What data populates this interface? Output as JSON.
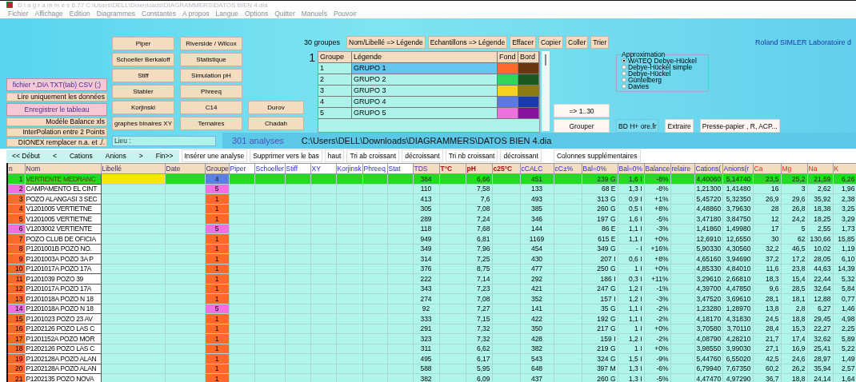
{
  "window": {
    "title": "D i a g r a m m e s   6.77   C:\\Users\\DELL\\Downloads\\DIAGRAMMERS\\DATOS BIEN 4.dia"
  },
  "menu": [
    "Fichier",
    "Affichage",
    "Edition",
    "Diagrammes",
    "Constantes",
    "A propos",
    "Langue",
    "Options",
    "Quitter",
    "Manuels",
    "Pouvoir"
  ],
  "file_buttons": [
    {
      "label": "fichier *.DIA TXT(tab) CSV (;)",
      "kind": "primary"
    },
    {
      "label": "Lire uniquement les données",
      "kind": "plain"
    },
    {
      "label": "Enregistrer le tableau",
      "kind": "primary"
    },
    {
      "label": "Modèle Balance xls",
      "kind": "plain"
    },
    {
      "label": "InterPolation entre 2 Points",
      "kind": "plain"
    },
    {
      "label": "DIONEX remplacer n.a. et ./.",
      "kind": "plain"
    }
  ],
  "diagram_buttons": [
    [
      "Piper",
      "Schoeller Berkaloff",
      "Stiff",
      "Stabler",
      "Korjinski",
      "graphes binaires XY"
    ],
    [
      "Riverside / Wilcox",
      "Statistique",
      "Simulation pH",
      "Phreeq",
      "C14",
      "Ternaires"
    ],
    [
      "Durov",
      "Chadah"
    ]
  ],
  "groups": {
    "count_label": "30 groupes",
    "current": "1",
    "buttons": [
      "Nom/Libellé => Légende",
      "Echantillons => Légende",
      "Effacer",
      "Copier",
      "Coller",
      "Trier"
    ],
    "columns": [
      "Groupe",
      "Légende",
      "Fond",
      "Bord"
    ],
    "rows": [
      {
        "number": "1",
        "legend": "GRUPO 1",
        "color": "#ff6a2a",
        "border": {
          "color": "#6b3510"
        },
        "selected": true
      },
      {
        "number": "2",
        "legend": "GRUPO 2",
        "color": "#33d45a",
        "border": {
          "color": "#1a5a22"
        },
        "selected": false
      },
      {
        "number": "3",
        "legend": "GRUPO 3",
        "color": "#f5d21e",
        "border": {
          "color": "#8a7a10"
        },
        "selected": false
      },
      {
        "number": "4",
        "legend": "GRUPO 4",
        "color": "#5a7ae0",
        "border": {
          "color": "#1a3aa8"
        },
        "selected": false
      },
      {
        "number": "5",
        "legend": "GRUPO 5",
        "color": "#f070e0",
        "border": {
          "color": "#8a10a0"
        },
        "selected": false
      }
    ],
    "range_buttons": [
      "=> 1..30",
      "Grouper"
    ]
  },
  "author": "Roland SIMLER Laboratoire d",
  "approximation": {
    "title": "Approximation",
    "options": [
      {
        "label": "WATEQ Debye-Hückel",
        "selected": true
      },
      {
        "label": "Debye-Hückel simple",
        "selected": false
      },
      {
        "label": "Debye-Hückel",
        "selected": false
      },
      {
        "label": "Güntelberg",
        "selected": false
      },
      {
        "label": "Davies",
        "selected": false
      }
    ]
  },
  "tool_buttons": [
    "BD H+ ore.fr",
    "Extraire",
    "Presse-papier , R, ACP..."
  ],
  "location": {
    "placeholder": "Lieu :"
  },
  "analysis_count": "301 analyses",
  "file_path": "C:\\Users\\DELL\\Downloads\\DIAGRAMMERS\\DATOS BIEN 4.dia",
  "navigation": [
    "<< Début",
    "<",
    "Cations",
    "Anions",
    ">",
    "Fin>>"
  ],
  "row_actions": [
    "Insérer une analyse",
    "Supprimer vers le bas",
    "haut",
    "Tri ab croissant",
    "décroissant",
    "Tri nb croissant",
    "décroissant",
    "Colonnes supplémentaires"
  ],
  "table": {
    "columns": [
      {
        "label": "n",
        "kind": "sample"
      },
      {
        "label": "Nom",
        "kind": "sample"
      },
      {
        "label": "Libellé",
        "kind": "sample"
      },
      {
        "label": "Date",
        "kind": "sample"
      },
      {
        "label": "Groupe",
        "kind": "sample"
      },
      {
        "label": "Piper",
        "kind": "diagram"
      },
      {
        "label": "Schoeller",
        "kind": "diagram"
      },
      {
        "label": "Stiff",
        "kind": "diagram"
      },
      {
        "label": "XY",
        "kind": "diagram"
      },
      {
        "label": "Korjinsk",
        "kind": "diagram"
      },
      {
        "label": "Phreeq",
        "kind": "diagram"
      },
      {
        "label": "Stat",
        "kind": "diagram"
      },
      {
        "label": "TDS",
        "kind": "total"
      },
      {
        "label": "T°C",
        "kind": "physical"
      },
      {
        "label": "pH",
        "kind": "physical"
      },
      {
        "label": "c25°C",
        "kind": "physical"
      },
      {
        "label": "cCALC",
        "kind": "computed"
      },
      {
        "label": "cC±%",
        "kind": "computed"
      },
      {
        "label": "Bal=0%",
        "kind": "computed"
      },
      {
        "label": "Bal=0%",
        "kind": "computed"
      },
      {
        "label": "Balance",
        "kind": "computed"
      },
      {
        "label": "relaire",
        "kind": "computed"
      },
      {
        "label": "Cations(",
        "kind": "computed"
      },
      {
        "label": "Anions(r",
        "kind": "computed"
      },
      {
        "label": "Ca",
        "kind": "ion"
      },
      {
        "label": "Mg",
        "kind": "ion"
      },
      {
        "label": "Na",
        "kind": "ion"
      },
      {
        "label": "K",
        "kind": "ion"
      }
    ],
    "rows": [
      {
        "n": "1",
        "name": "VERTIENTE MEDRANC",
        "group": "4",
        "color": "#5a80e0",
        "selected": true,
        "tds": "384",
        "ph": "6,66",
        "ccalc": "451",
        "bal_mg": "239 G",
        "bal_ratio": "1,6 I",
        "balance": "-8%",
        "cations": "4,40060",
        "anions": "5,14740",
        "ca": "23,5",
        "mg": "25,2",
        "na": "21,59",
        "k": "6,26"
      },
      {
        "n": "2",
        "name": "CAMPAMENTO EL CINT",
        "group": "5",
        "color": "#f070e0",
        "selected": false,
        "tds": "110",
        "ph": "7,58",
        "ccalc": "133",
        "bal_mg": "68 E",
        "bal_ratio": "1,3 I",
        "balance": "-8%",
        "cations": "1,21300",
        "anions": "1,41480",
        "ca": "16",
        "mg": "3",
        "na": "2,62",
        "k": "1,96"
      },
      {
        "n": "3",
        "name": "POZO ALANGASI 3 SEC",
        "group": "1",
        "color": "#ff6a2a",
        "selected": false,
        "tds": "413",
        "ph": "7,6",
        "ccalc": "493",
        "bal_mg": "313 G",
        "bal_ratio": "0,9 I",
        "balance": "+1%",
        "cations": "5,45720",
        "anions": "5,32350",
        "ca": "26,9",
        "mg": "29,6",
        "na": "35,92",
        "k": "2,38"
      },
      {
        "n": "4",
        "name": "V1201005 VERTIETNE",
        "group": "1",
        "color": "#ff6a2a",
        "selected": false,
        "tds": "305",
        "ph": "7,08",
        "ccalc": "385",
        "bal_mg": "260 G",
        "bal_ratio": "0,5 I",
        "balance": "+8%",
        "cations": "4,48860",
        "anions": "3,79630",
        "ca": "28",
        "mg": "26,8",
        "na": "18,38",
        "k": "3,25"
      },
      {
        "n": "5",
        "name": "V1201005 VERTIETNE",
        "group": "1",
        "color": "#ff6a2a",
        "selected": false,
        "tds": "289",
        "ph": "7,24",
        "ccalc": "346",
        "bal_mg": "197 G",
        "bal_ratio": "1,6 I",
        "balance": "-5%",
        "cations": "3,47180",
        "anions": "3,84750",
        "ca": "12",
        "mg": "24,2",
        "na": "18,25",
        "k": "3,29"
      },
      {
        "n": "6",
        "name": "V1203002 VERTIENTE",
        "group": "5",
        "color": "#f070e0",
        "selected": false,
        "tds": "118",
        "ph": "7,68",
        "ccalc": "144",
        "bal_mg": "86 E",
        "bal_ratio": "1,1 I",
        "balance": "-3%",
        "cations": "1,41860",
        "anions": "1,49980",
        "ca": "17",
        "mg": "5",
        "na": "2,55",
        "k": "1,73"
      },
      {
        "n": "7",
        "name": "POZO CLUB DE OFICIA",
        "group": "1",
        "color": "#ff6a2a",
        "selected": false,
        "tds": "949",
        "ph": "6,81",
        "ccalc": "1169",
        "bal_mg": "615 E",
        "bal_ratio": "1,1 I",
        "balance": "+0%",
        "cations": "12,6910",
        "anions": "12,6550",
        "ca": "30",
        "mg": "62",
        "na": "130,66",
        "k": "15,85"
      },
      {
        "n": "8",
        "name": "P1201001B POZO NO.",
        "group": "1",
        "color": "#ff6a2a",
        "selected": false,
        "tds": "349",
        "ph": "7,96",
        "ccalc": "454",
        "bal_mg": "349 G",
        "bal_ratio": "- I",
        "balance": "+16%",
        "cations": "5,90330",
        "anions": "4,30560",
        "ca": "32,2",
        "mg": "46,5",
        "na": "10,02",
        "k": "1,19"
      },
      {
        "n": "9",
        "name": "P1201003A POZO 3A P",
        "group": "1",
        "color": "#ff6a2a",
        "selected": false,
        "tds": "314",
        "ph": "7,25",
        "ccalc": "430",
        "bal_mg": "207 I",
        "bal_ratio": "0,6 I",
        "balance": "+8%",
        "cations": "4,65160",
        "anions": "3,94690",
        "ca": "37,2",
        "mg": "17,2",
        "na": "28,05",
        "k": "6,10"
      },
      {
        "n": "10",
        "name": "P1201017A POZO 17A",
        "group": "1",
        "color": "#ff6a2a",
        "selected": false,
        "tds": "376",
        "ph": "8,75",
        "ccalc": "477",
        "bal_mg": "250 G",
        "bal_ratio": "1 I",
        "balance": "+0%",
        "cations": "4,85330",
        "anions": "4,84010",
        "ca": "11,6",
        "mg": "23,8",
        "na": "44,63",
        "k": "14,39"
      },
      {
        "n": "11",
        "name": "P1201039 POZO 39",
        "group": "1",
        "color": "#ff6a2a",
        "selected": false,
        "tds": "222",
        "ph": "7,14",
        "ccalc": "292",
        "bal_mg": "186 I",
        "bal_ratio": "0,3 I",
        "balance": "+11%",
        "cations": "3,29610",
        "anions": "2,66810",
        "ca": "18,3",
        "mg": "15,4",
        "na": "22,44",
        "k": "5,32"
      },
      {
        "n": "12",
        "name": "P1201017A POZO 17A",
        "group": "1",
        "color": "#ff6a2a",
        "selected": false,
        "tds": "343",
        "ph": "7,23",
        "ccalc": "421",
        "bal_mg": "247 G",
        "bal_ratio": "1,2 I",
        "balance": "-1%",
        "cations": "4,39700",
        "anions": "4,47850",
        "ca": "9,6",
        "mg": "28,5",
        "na": "32,64",
        "k": "5,84"
      },
      {
        "n": "13",
        "name": "P1201018A POZO N 18",
        "group": "1",
        "color": "#ff6a2a",
        "selected": false,
        "tds": "274",
        "ph": "7,08",
        "ccalc": "352",
        "bal_mg": "157 I",
        "bal_ratio": "1,2 I",
        "balance": "-3%",
        "cations": "3,47520",
        "anions": "3,69610",
        "ca": "28,1",
        "mg": "18,1",
        "na": "12,88",
        "k": "0,77"
      },
      {
        "n": "14",
        "name": "P1201018A POZO N 18",
        "group": "5",
        "color": "#f070e0",
        "selected": false,
        "tds": "92",
        "ph": "7,27",
        "ccalc": "141",
        "bal_mg": "35 G",
        "bal_ratio": "1,1 I",
        "balance": "-2%",
        "cations": "1,23280",
        "anions": "1,28970",
        "ca": "13,8",
        "mg": "2,8",
        "na": "6,27",
        "k": "1,46"
      },
      {
        "n": "15",
        "name": "P1201023 POZO 23 AV",
        "group": "1",
        "color": "#ff6a2a",
        "selected": false,
        "tds": "333",
        "ph": "7,15",
        "ccalc": "422",
        "bal_mg": "192 G",
        "bal_ratio": "1,1 I",
        "balance": "-2%",
        "cations": "4,18170",
        "anions": "4,31830",
        "ca": "24,5",
        "mg": "18,8",
        "na": "29,45",
        "k": "4,98"
      },
      {
        "n": "16",
        "name": "P1202126 POZO LAS C",
        "group": "1",
        "color": "#ff6a2a",
        "selected": false,
        "tds": "291",
        "ph": "7,32",
        "ccalc": "350",
        "bal_mg": "217 G",
        "bal_ratio": "1 I",
        "balance": "+0%",
        "cations": "3,70580",
        "anions": "3,70110",
        "ca": "28,4",
        "mg": "15,3",
        "na": "22,27",
        "k": "2,25"
      },
      {
        "n": "17",
        "name": "P1201152A POZO MOR",
        "group": "1",
        "color": "#ff6a2a",
        "selected": false,
        "tds": "323",
        "ph": "7,32",
        "ccalc": "428",
        "bal_mg": "159 I",
        "bal_ratio": "1,2 I",
        "balance": "-2%",
        "cations": "4,08790",
        "anions": "4,28210",
        "ca": "21,7",
        "mg": "17,4",
        "na": "32,62",
        "k": "5,89"
      },
      {
        "n": "18",
        "name": "P1202126 POZO LAS C",
        "group": "1",
        "color": "#ff6a2a",
        "selected": false,
        "tds": "311",
        "ph": "6,62",
        "ccalc": "382",
        "bal_mg": "219 G",
        "bal_ratio": "1 I",
        "balance": "+0%",
        "cations": "3,98550",
        "anions": "3,99030",
        "ca": "27,1",
        "mg": "16,9",
        "na": "25,41",
        "k": "5,22"
      },
      {
        "n": "19",
        "name": "P1202128A POZO ALAN",
        "group": "1",
        "color": "#ff6a2a",
        "selected": false,
        "tds": "495",
        "ph": "6,17",
        "ccalc": "543",
        "bal_mg": "324 G",
        "bal_ratio": "1,5 I",
        "balance": "-9%",
        "cations": "5,44760",
        "anions": "6,55020",
        "ca": "42,5",
        "mg": "24,6",
        "na": "28,97",
        "k": "1,49"
      },
      {
        "n": "20",
        "name": "P1202128A POZO ALAN",
        "group": "1",
        "color": "#ff6a2a",
        "selected": false,
        "tds": "588",
        "ph": "5,95",
        "ccalc": "648",
        "bal_mg": "397 M",
        "bal_ratio": "1,3 I",
        "balance": "-6%",
        "cations": "6,79940",
        "anions": "7,67350",
        "ca": "60,2",
        "mg": "26,2",
        "na": "35,94",
        "k": "2,57"
      },
      {
        "n": "21",
        "name": "P1202135 POZO NOVA",
        "group": "1",
        "color": "#ff6a2a",
        "selected": false,
        "tds": "382",
        "ph": "6,09",
        "ccalc": "437",
        "bal_mg": "260 G",
        "bal_ratio": "1,3 I",
        "balance": "-5%",
        "cations": "4,47470",
        "anions": "4,97290",
        "ca": "36,7",
        "mg": "18,8",
        "na": "24,14",
        "k": "1,64"
      }
    ]
  }
}
